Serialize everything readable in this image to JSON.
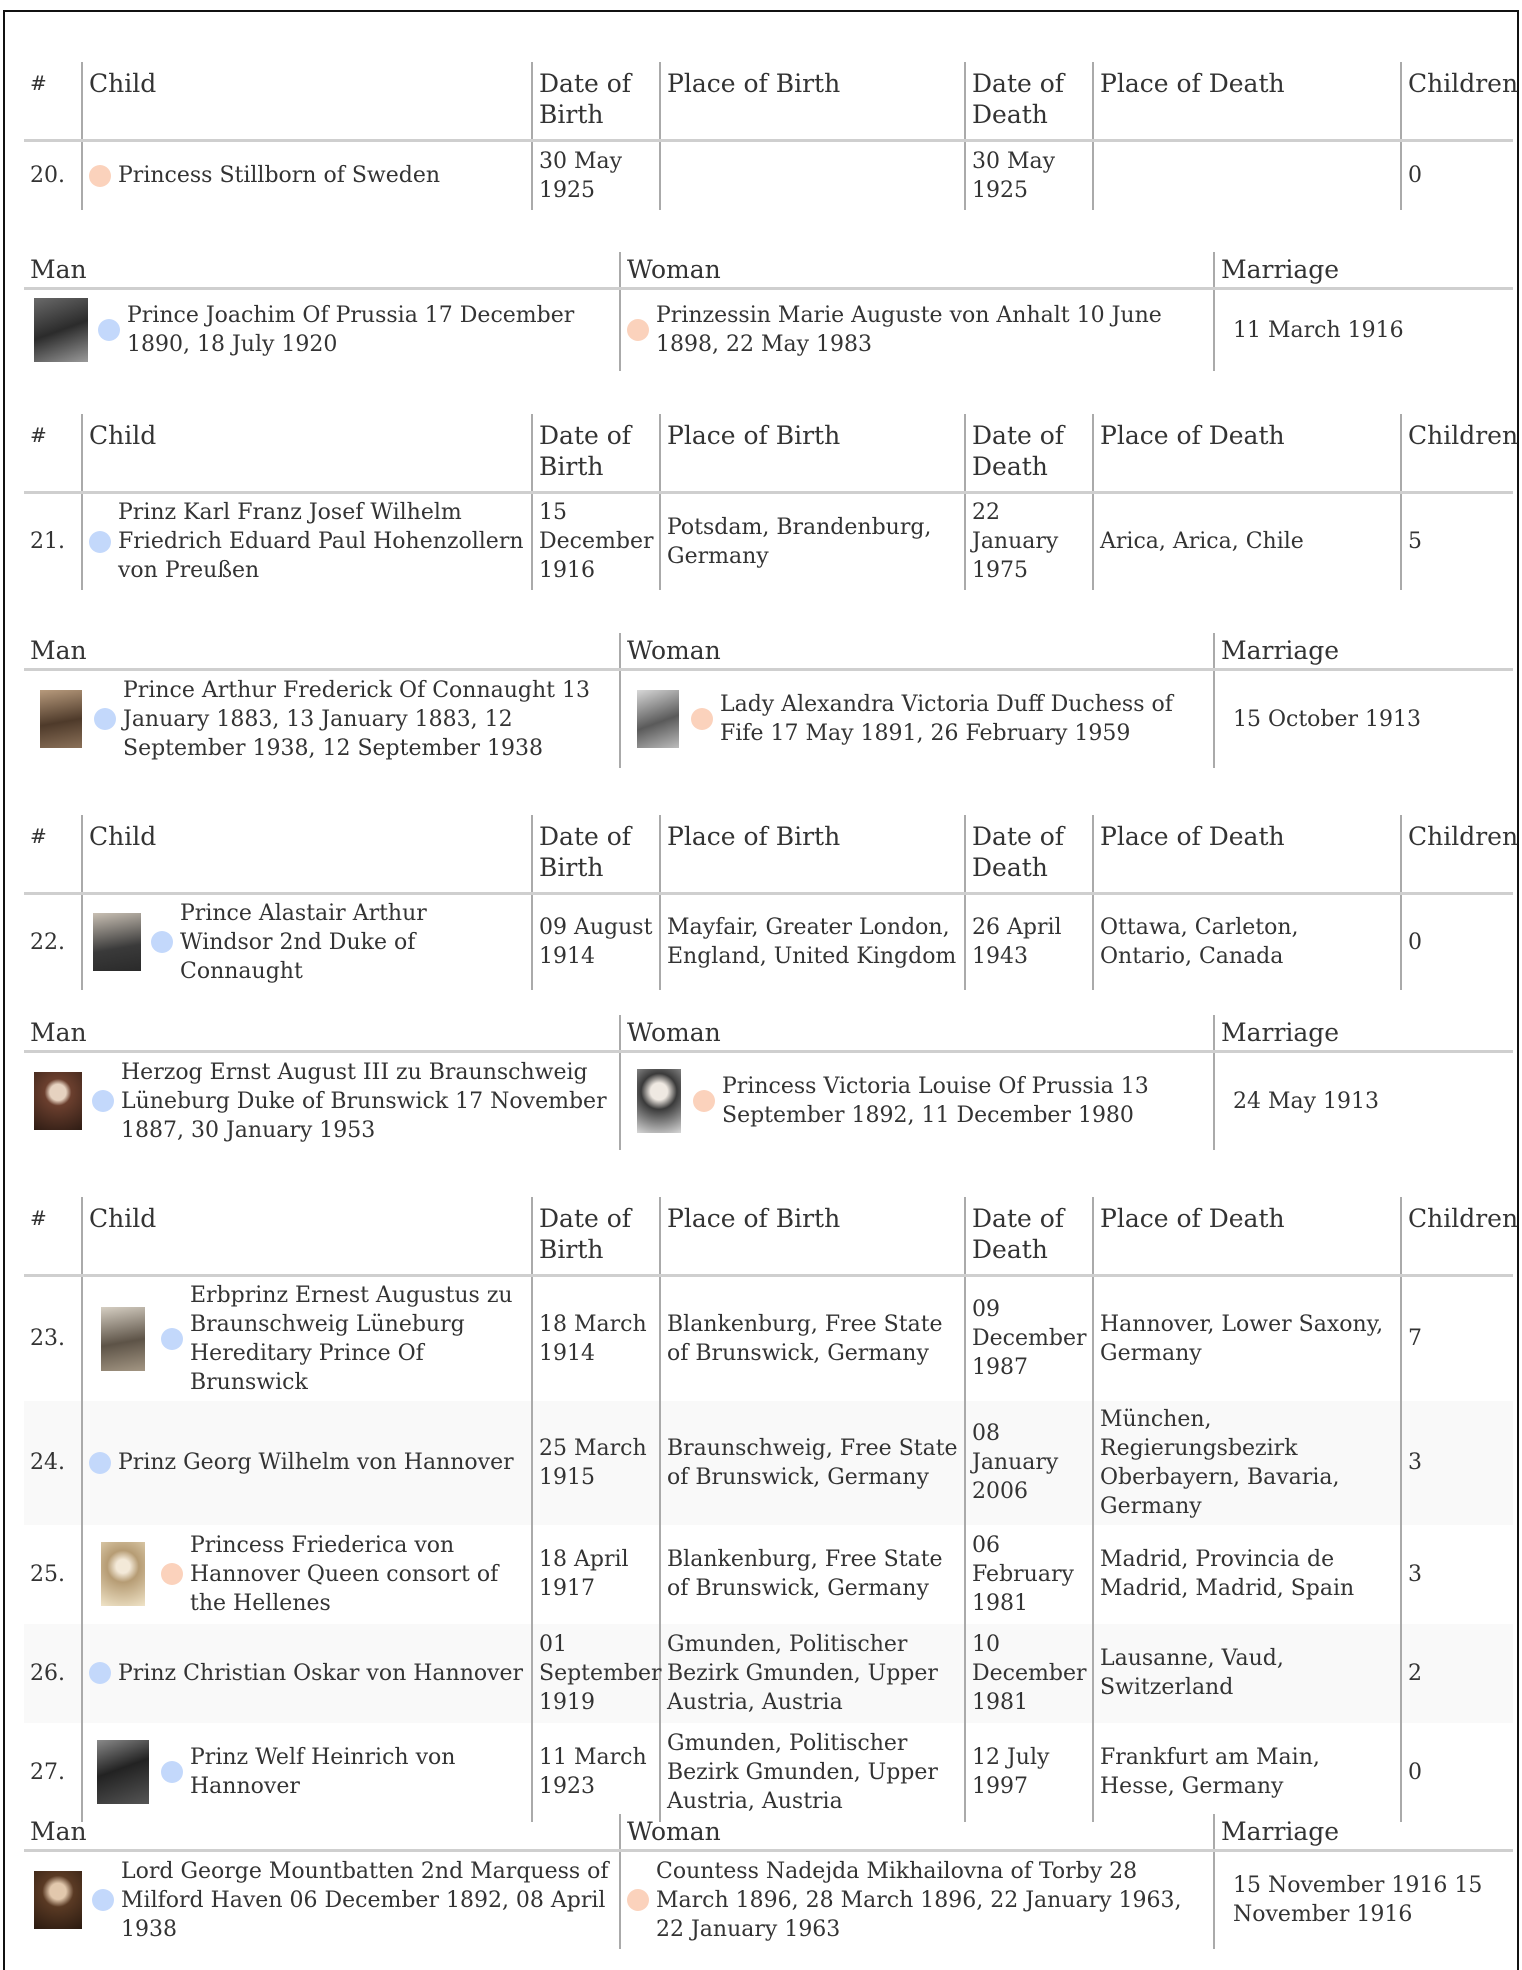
{
  "child_headers": {
    "num": "#",
    "child": "Child",
    "dob": "Date of Birth",
    "pob": "Place of Birth",
    "dod": "Date of Death",
    "pod": "Place of Death",
    "children": "Children"
  },
  "couple_headers": {
    "man": "Man",
    "woman": "Woman",
    "marriage": "Marriage"
  },
  "blocks": [
    {
      "kind": "children",
      "rows": [
        {
          "num": "20.",
          "name": "Princess Stillborn of Sweden",
          "sex": "female",
          "dob": "30 May 1925",
          "pob": "",
          "dod": "30 May 1925",
          "pod": "",
          "children": "0"
        }
      ]
    },
    {
      "kind": "couple",
      "man": "Prince Joachim Of Prussia 17 December 1890, 18 July 1920",
      "woman": "Prinzessin Marie Auguste von Anhalt 10 June 1898, 22 May 1983",
      "marriage": "11 March 1916"
    },
    {
      "kind": "children",
      "rows": [
        {
          "num": "21.",
          "name": "Prinz Karl Franz Josef Wilhelm Friedrich Eduard Paul Hohenzollern von Preußen",
          "sex": "male",
          "dob": "15 December 1916",
          "pob": "Potsdam, Brandenburg, Germany",
          "dod": "22 January 1975",
          "pod": "Arica, Arica, Chile",
          "children": "5"
        }
      ]
    },
    {
      "kind": "couple",
      "man": "Prince Arthur Frederick Of Connaught 13 January 1883, 13 January 1883, 12 September 1938, 12 September 1938",
      "woman": "Lady Alexandra Victoria Duff Duchess of Fife 17 May 1891, 26 February 1959",
      "marriage": "15 October 1913"
    },
    {
      "kind": "children",
      "rows": [
        {
          "num": "22.",
          "name": "Prince Alastair Arthur Windsor 2nd Duke of Connaught",
          "sex": "male",
          "dob": "09 August 1914",
          "pob": "Mayfair, Greater London, England, United Kingdom",
          "dod": "26 April 1943",
          "pod": "Ottawa, Carleton, Ontario, Canada",
          "children": "0"
        }
      ]
    },
    {
      "kind": "couple",
      "man": "Herzog Ernst August III zu Braunschweig Lüneburg Duke of Brunswick 17 November 1887, 30 January 1953",
      "woman": "Princess Victoria Louise Of Prussia 13 September 1892, 11 December 1980",
      "marriage": "24 May 1913"
    },
    {
      "kind": "children",
      "rows": [
        {
          "num": "23.",
          "name": "Erbprinz Ernest Augustus zu Braunschweig Lüneburg Hereditary Prince Of Brunswick",
          "sex": "male",
          "dob": "18 March 1914",
          "pob": "Blankenburg, Free State of Brunswick, Germany",
          "dod": "09 December 1987",
          "pod": "Hannover, Lower Saxony, Germany",
          "children": "7"
        },
        {
          "num": "24.",
          "name": "Prinz Georg Wilhelm von Hannover",
          "sex": "male",
          "dob": "25 March 1915",
          "pob": "Braunschweig, Free State of Brunswick, Germany",
          "dod": "08 January 2006",
          "pod": "München, Regierungsbezirk Oberbayern, Bavaria, Germany",
          "children": "3"
        },
        {
          "num": "25.",
          "name": "Princess Friederica von Hannover Queen consort of the Hellenes",
          "sex": "female",
          "dob": "18 April 1917",
          "pob": "Blankenburg, Free State of Brunswick, Germany",
          "dod": "06 February 1981",
          "pod": "Madrid, Provincia de Madrid, Madrid, Spain",
          "children": "3"
        },
        {
          "num": "26.",
          "name": "Prinz Christian Oskar von Hannover",
          "sex": "male",
          "dob": "01 September 1919",
          "pob": "Gmunden, Politischer Bezirk Gmunden, Upper Austria, Austria",
          "dod": "10 December 1981",
          "pod": "Lausanne, Vaud, Switzerland",
          "children": "2"
        },
        {
          "num": "27.",
          "name": "Prinz Welf Heinrich von Hannover",
          "sex": "male",
          "dob": "11 March 1923",
          "pob": "Gmunden, Politischer Bezirk Gmunden, Upper Austria, Austria",
          "dod": "12 July 1997",
          "pod": "Frankfurt am Main, Hesse, Germany",
          "children": "0"
        }
      ]
    },
    {
      "kind": "couple",
      "man": "Lord George Mountbatten 2nd Marquess of Milford Haven 06 December 1892, 08 April 1938",
      "woman": "Countess Nadejda Mikhailovna of Torby 28 March 1896, 28 March 1896, 22 January 1963, 22 January 1963",
      "marriage": "15 November 1916 15 November 1916"
    }
  ]
}
